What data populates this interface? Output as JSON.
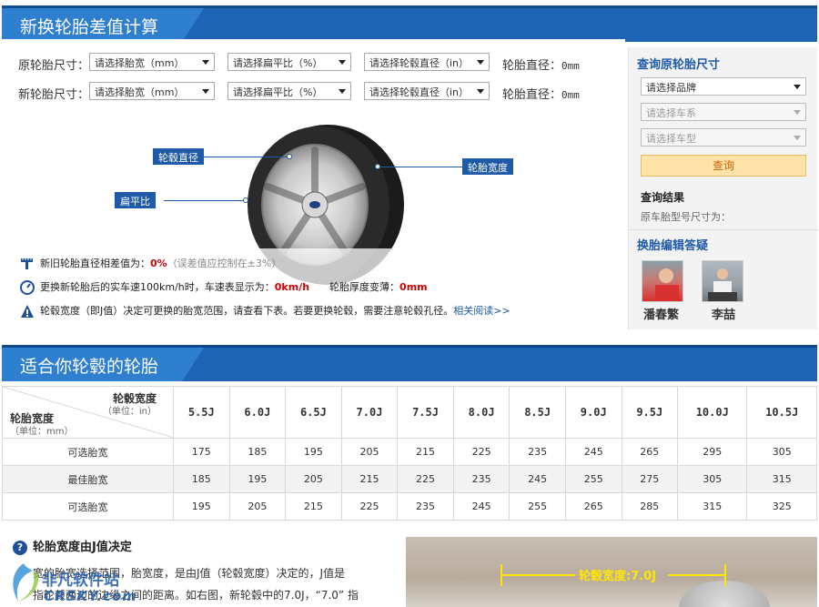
{
  "section1": {
    "title": "新换轮胎差值计算"
  },
  "section2": {
    "title": "适合你轮毂的轮胎"
  },
  "calc": {
    "orig_label": "原轮胎尺寸：",
    "new_label": "新轮胎尺寸：",
    "width_placeholder": "请选择胎宽（mm）",
    "ratio_placeholder": "请选择扁平比（%）",
    "rim_placeholder": "请选择轮毂直径（in）",
    "diam_label": "轮胎直径：",
    "diam_value": "0mm"
  },
  "diagram": {
    "rim_diameter": "轮毂直径",
    "aspect_ratio": "扁平比",
    "tire_width": "轮胎宽度"
  },
  "notes": {
    "n1_prefix": "新旧轮胎直径相差值为：",
    "n1_value": "0%",
    "n1_suffix": "（误差值应控制在±3%）",
    "n2_prefix": "更换新轮胎后的实车速100km/h时，车速表显示为：",
    "n2_value": "0km/h",
    "n2_mid": "轮胎厚度变薄：",
    "n2_value2": "0mm",
    "n3_text": "轮毂宽度（即J值）决定可更换的胎宽范围，请查看下表。若要更换轮毂，需要注意轮毂孔径。",
    "n3_link": "相关阅读>>"
  },
  "panel": {
    "title": "查询原轮胎尺寸",
    "brand_placeholder": "请选择品牌",
    "series_placeholder": "请选择车系",
    "model_placeholder": "请选择车型",
    "query_button": "查询",
    "result_title": "查询结果",
    "result_text": "原车胎型号尺寸为：",
    "editors_title": "换胎编辑答疑",
    "editor1": "潘春繁",
    "editor2": "李喆"
  },
  "table": {
    "corner_top": "轮毂宽度",
    "corner_top_unit": "（单位：in）",
    "corner_left": "轮胎宽度",
    "corner_left_unit": "（单位：mm）",
    "columns": [
      "5.5J",
      "6.0J",
      "6.5J",
      "7.0J",
      "7.5J",
      "8.0J",
      "8.5J",
      "9.0J",
      "9.5J",
      "10.0J",
      "10.5J"
    ],
    "rows": [
      {
        "label": "可选胎宽",
        "values": [
          "175",
          "185",
          "195",
          "205",
          "215",
          "225",
          "235",
          "245",
          "265",
          "295",
          "305"
        ]
      },
      {
        "label": "最佳胎宽",
        "values": [
          "185",
          "195",
          "205",
          "215",
          "225",
          "235",
          "245",
          "255",
          "275",
          "305",
          "315"
        ]
      },
      {
        "label": "可选胎宽",
        "values": [
          "195",
          "205",
          "215",
          "225",
          "235",
          "245",
          "255",
          "265",
          "285",
          "315",
          "325"
        ]
      }
    ]
  },
  "article": {
    "title": "轮胎宽度由J值决定",
    "line1": "宽的胎宽选择范围，胎宽度，是由J值（轮毂宽度）决定的，J值是",
    "line2": "指轮毂两边的边缘之间的距离。如右图，新轮毂中的7.0J，“7.0” 指",
    "photo_label": "轮毂宽度:7.0J"
  },
  "watermark": {
    "line1": "非凡软件站",
    "line2": "CRSKY.com"
  },
  "colors": {
    "header_blue": "#1e64b4",
    "accent_blue": "#1e5aa8",
    "warning_red": "#d10000",
    "query_orange": "#ffe3a8"
  }
}
